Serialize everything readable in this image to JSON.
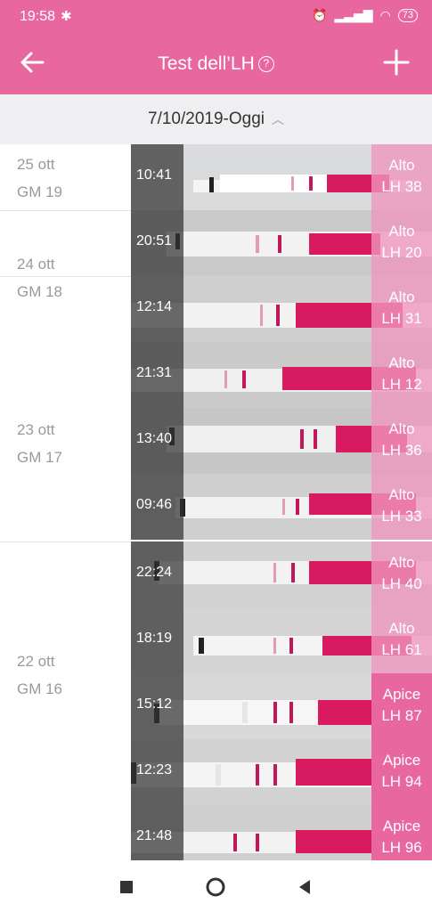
{
  "status": {
    "time": "19:58",
    "battery": "73"
  },
  "header": {
    "title": "Test dell’LH",
    "help_glyph": "?"
  },
  "range": {
    "label": "7/10/2019-Oggi"
  },
  "days": [
    {
      "date": "25 ott",
      "cycle_day": "GM 19"
    },
    {
      "date": "24 ott",
      "cycle_day": "GM 18"
    },
    {
      "date": "23 ott",
      "cycle_day": "GM 17"
    },
    {
      "date": "22 ott",
      "cycle_day": "GM 16"
    }
  ],
  "tests": [
    {
      "time": "10:41",
      "status": "Alto",
      "lh": "LH 38"
    },
    {
      "time": "20:51",
      "status": "Alto",
      "lh": "LH 20"
    },
    {
      "time": "12:14",
      "status": "Alto",
      "lh": "LH 31"
    },
    {
      "time": "21:31",
      "status": "Alto",
      "lh": "LH 12"
    },
    {
      "time": "13:40",
      "status": "Alto",
      "lh": "LH 36"
    },
    {
      "time": "09:46",
      "status": "Alto",
      "lh": "LH 33"
    },
    {
      "time": "22:24",
      "status": "Alto",
      "lh": "LH 40"
    },
    {
      "time": "18:19",
      "status": "Alto",
      "lh": "LH 61"
    },
    {
      "time": "15:12",
      "status": "Apice",
      "lh": "LH 87"
    },
    {
      "time": "12:23",
      "status": "Apice",
      "lh": "LH 94"
    },
    {
      "time": "21:48",
      "status": "Apice",
      "lh": "LH 96"
    }
  ],
  "colors": {
    "brand": "#e9679f",
    "strip_pink": "#d81b60",
    "high_overlay": "#f096be"
  }
}
